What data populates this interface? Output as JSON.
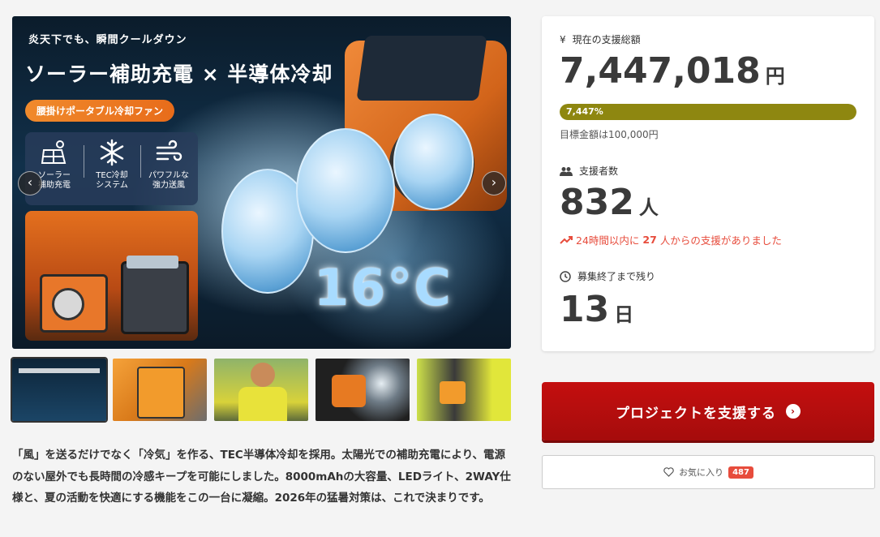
{
  "main_image": {
    "headline": "炎天下でも、瞬間クールダウン",
    "title": "ソーラー補助充電 × 半導体冷却",
    "pill": "腰掛けポータブル冷却ファン",
    "features": [
      {
        "icon": "solar-panel-icon",
        "line1": "ソーラー",
        "line2": "補助充電"
      },
      {
        "icon": "snowflake-icon",
        "line1": "TEC冷却",
        "line2": "システム"
      },
      {
        "icon": "wind-icon",
        "line1": "パワフルな",
        "line2": "強力送風"
      }
    ],
    "temperature": "16°C",
    "prev_label": "‹",
    "next_label": "›"
  },
  "description": "「風」を送るだけでなく「冷気」を作る、TEC半導体冷却を採用。太陽光での補助充電により、電源のない屋外でも長時間の冷感キープを可能にしました。8000mAhの大容量、LEDライト、2WAY仕様と、夏の活動を快適にする機能をこの一台に凝縮。2026年の猛暑対策は、これで決まりです。",
  "stats": {
    "total_label": "現在の支援総額",
    "total_value": "7,447,018",
    "total_unit": "円",
    "progress_text": "7,447%",
    "progress_fraction": 1.0,
    "goal_text": "目標金額は100,000円",
    "backers_label": "支援者数",
    "backers_value": "832",
    "backers_unit": "人",
    "trend_prefix": "24時間以内に",
    "trend_count": "27",
    "trend_suffix": "人からの支援がありました",
    "remaining_label": "募集終了まで残り",
    "remaining_value": "13",
    "remaining_unit": "日"
  },
  "actions": {
    "support_label": "プロジェクトを支援する",
    "favorite_label": "お気に入り",
    "favorite_count": "487"
  },
  "colors": {
    "accent_red": "#b00d0d",
    "progress": "#8e8710",
    "trend": "#e74c3c"
  }
}
